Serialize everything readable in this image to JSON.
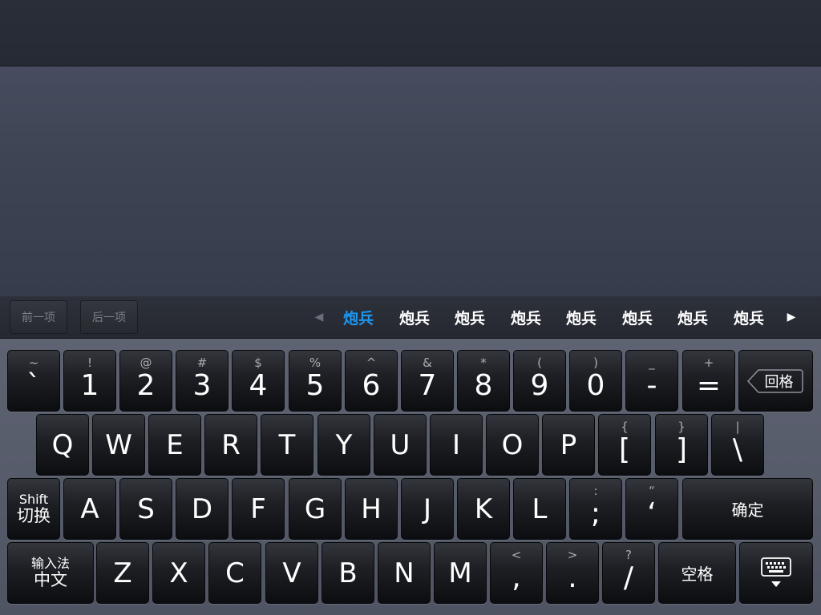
{
  "nav": {
    "prev": "前一项",
    "next": "后一项"
  },
  "candidates": [
    "炮兵",
    "炮兵",
    "炮兵",
    "炮兵",
    "炮兵",
    "炮兵",
    "炮兵",
    "炮兵"
  ],
  "selected_candidate": 0,
  "keys": {
    "row1": [
      {
        "top": "~",
        "main": "`"
      },
      {
        "top": "!",
        "main": "1"
      },
      {
        "top": "@",
        "main": "2"
      },
      {
        "top": "#",
        "main": "3"
      },
      {
        "top": "$",
        "main": "4"
      },
      {
        "top": "%",
        "main": "5"
      },
      {
        "top": "^",
        "main": "6"
      },
      {
        "top": "&",
        "main": "7"
      },
      {
        "top": "*",
        "main": "8"
      },
      {
        "top": "(",
        "main": "9"
      },
      {
        "top": ")",
        "main": "0"
      },
      {
        "top": "_",
        "main": "-"
      },
      {
        "top": "+",
        "main": "="
      }
    ],
    "backspace": "回格",
    "row2": [
      "Q",
      "W",
      "E",
      "R",
      "T",
      "Y",
      "U",
      "I",
      "O",
      "P"
    ],
    "row2_sym": [
      {
        "top": "{",
        "main": "["
      },
      {
        "top": "}",
        "main": "]"
      },
      {
        "top": "|",
        "main": "\\"
      }
    ],
    "shift_top": "Shift",
    "shift_bottom": "切换",
    "row3": [
      "A",
      "S",
      "D",
      "F",
      "G",
      "H",
      "J",
      "K",
      "L"
    ],
    "row3_sym": [
      {
        "top": ":",
        "main": ";"
      },
      {
        "top": "“",
        "main": "‘"
      }
    ],
    "confirm": "确定",
    "ime_top": "输入法",
    "ime_bottom": "中文",
    "row4": [
      "Z",
      "X",
      "C",
      "V",
      "B",
      "N",
      "M"
    ],
    "row4_sym": [
      {
        "top": "<",
        "main": ","
      },
      {
        "top": ">",
        "main": "."
      },
      {
        "top": "?",
        "main": "/"
      }
    ],
    "space": "空格"
  },
  "colors": {
    "selected_candidate": "#1e96f0",
    "key_text": "#ffffff"
  }
}
